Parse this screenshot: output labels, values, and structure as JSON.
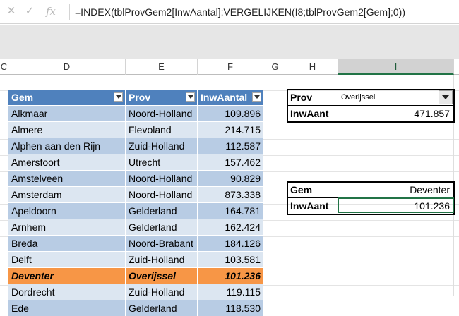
{
  "formula_bar": {
    "cancel_icon": "x-icon",
    "enter_icon": "check-icon",
    "function_icon": "fx-icon",
    "formula": "=INDEX(tblProvGem2[InwAantal];VERGELIJKEN(I8;tblProvGem2[Gem];0))"
  },
  "columns": [
    {
      "label": "C",
      "selected": false
    },
    {
      "label": "D",
      "selected": false
    },
    {
      "label": "E",
      "selected": false
    },
    {
      "label": "F",
      "selected": false
    },
    {
      "label": "G",
      "selected": false
    },
    {
      "label": "H",
      "selected": false
    },
    {
      "label": "I",
      "selected": true
    }
  ],
  "table": {
    "headers": [
      "Gem",
      "Prov",
      "InwAantal"
    ],
    "rows": [
      [
        "Alkmaar",
        "Noord-Holland",
        "109.896"
      ],
      [
        "Almere",
        "Flevoland",
        "214.715"
      ],
      [
        "Alphen aan den Rijn",
        "Zuid-Holland",
        "112.587"
      ],
      [
        "Amersfoort",
        "Utrecht",
        "157.462"
      ],
      [
        "Amstelveen",
        "Noord-Holland",
        "90.829"
      ],
      [
        "Amsterdam",
        "Noord-Holland",
        "873.338"
      ],
      [
        "Apeldoorn",
        "Gelderland",
        "164.781"
      ],
      [
        "Arnhem",
        "Gelderland",
        "162.424"
      ],
      [
        "Breda",
        "Noord-Brabant",
        "184.126"
      ],
      [
        "Delft",
        "Zuid-Holland",
        "103.581"
      ],
      [
        "Deventer",
        "Overijssel",
        "101.236"
      ],
      [
        "Dordrecht",
        "Zuid-Holland",
        "119.115"
      ],
      [
        "Ede",
        "Gelderland",
        "118.530"
      ]
    ],
    "highlight_row": 10,
    "colors": {
      "header": "#4f81bd",
      "band_dark": "#b8cce4",
      "band_light": "#dce6f1",
      "highlight": "#f79646"
    }
  },
  "prov_box": {
    "label1": "Prov",
    "value1": "Overijssel",
    "label2": "InwAant",
    "value2": "471.857"
  },
  "gem_box": {
    "label1": "Gem",
    "value1": "Deventer",
    "label2": "InwAant",
    "value2": "101.236"
  }
}
